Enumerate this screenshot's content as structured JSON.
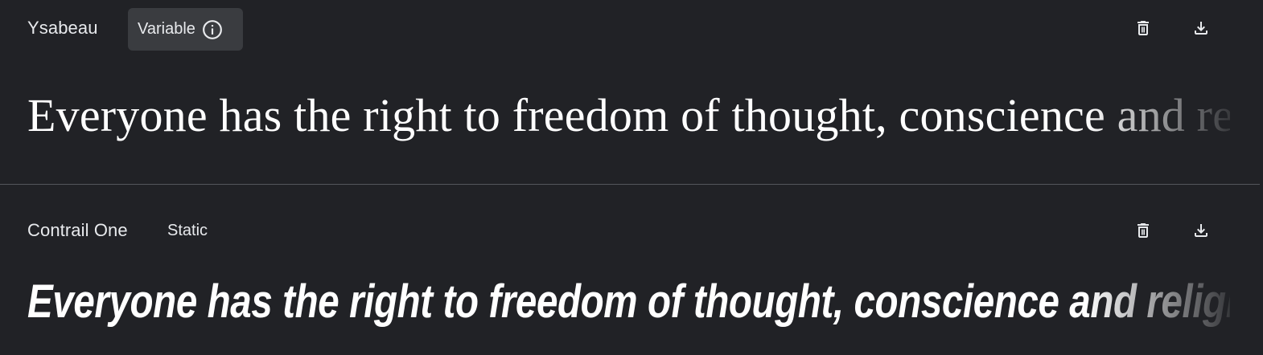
{
  "fonts": [
    {
      "name": "Ysabeau",
      "type_label": "Variable",
      "sample_text": "Everyone has the right to freedom of thought, conscience and religion"
    },
    {
      "name": "Contrail One",
      "type_label": "Static",
      "sample_text": "Everyone has the right to freedom of thought, conscience and religion"
    }
  ],
  "icons": {
    "info": "info-icon",
    "delete": "trash-icon",
    "download": "download-icon"
  },
  "colors": {
    "background": "#212226",
    "text": "#e8eaed",
    "chip_background": "#3a3c40",
    "divider": "#54565b"
  }
}
